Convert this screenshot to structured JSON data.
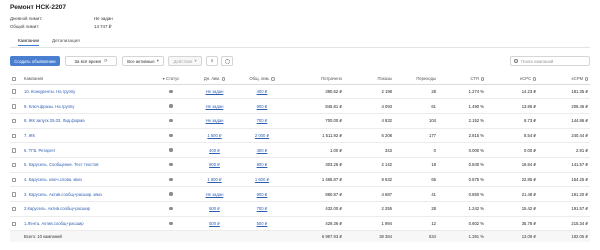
{
  "page": {
    "title": "Ремонт НСК-2207",
    "daily_limit_label": "Дневной лимит:",
    "daily_limit_value": "Не задан",
    "total_limit_label": "Общий лимит:",
    "total_limit_value": "14 747 ₽"
  },
  "tabs": [
    {
      "label": "Кампании",
      "active": true
    },
    {
      "label": "Детализация",
      "active": false
    }
  ],
  "toolbar": {
    "create_label": "Создать объявление",
    "period_label": "За всё время",
    "filter_label": "Все активные",
    "actions_label": "Действия",
    "search_placeholder": "Поиск кампаний"
  },
  "table": {
    "headers": {
      "campaign": "Кампания",
      "status": "Статус",
      "daily_limit": "Дн. лим.",
      "total_limit": "Общ. лим.",
      "spent": "Потрачено",
      "impressions": "Показы",
      "clicks": "Переходы",
      "ctr": "CTR",
      "ecpc": "eCPC",
      "ecpm": "eCPM"
    },
    "rows": [
      {
        "name": "10. Конкуренты. На группу",
        "daily": "Не задан",
        "total": "400 ₽",
        "spent": "390.62 ₽",
        "impressions": "2 198",
        "clicks": "28",
        "ctr": "1.274 %",
        "ecpc": "14.23 ₽",
        "ecpm": "181.35 ₽"
      },
      {
        "name": "9. Ключ.фразы. На группу",
        "daily": "Не задан",
        "total": "900 ₽",
        "spent": "845.81 ₽",
        "impressions": "4 093",
        "clicks": "61",
        "ctr": "1.490 %",
        "ecpc": "13.86 ₽",
        "ecpm": "206.45 ₽"
      },
      {
        "name": "8. ЖК запуск 25.03. Лид.форма",
        "daily": "Не задан",
        "total": "700 ₽",
        "spent": "700.00 ₽",
        "impressions": "4 832",
        "clicks": "104",
        "ctr": "2.152 %",
        "ecpc": "6.73 ₽",
        "ecpm": "144.86 ₽"
      },
      {
        "name": "7. ЖК",
        "daily": "1 500 ₽",
        "total": "2 000 ₽",
        "spent": "1 511.92 ₽",
        "impressions": "6 208",
        "clicks": "177",
        "ctr": "2.815 %",
        "ecpc": "8.54 ₽",
        "ecpm": "240.44 ₽"
      },
      {
        "name": "6. ТГБ. Ретаргет",
        "daily": "400 ₽",
        "total": "400 ₽",
        "spent": "1.00 ₽",
        "impressions": "343",
        "clicks": "0",
        "ctr": "0.000 %",
        "ecpc": "0.00 ₽",
        "ecpm": "2.91 ₽"
      },
      {
        "name": "5. Карусель. Сообщение. Тест текстов",
        "daily": "800 ₽",
        "total": "800 ₽",
        "spent": "303.26 ₽",
        "impressions": "2 142",
        "clicks": "18",
        "ctr": "0.840 %",
        "ecpc": "16.84 ₽",
        "ecpm": "141.57 ₽"
      },
      {
        "name": "4. Карусель. ключ.слова. квиз",
        "daily": "1 600 ₽",
        "total": "1 600 ₽",
        "spent": "1 485.87 ₽",
        "impressions": "9 632",
        "clicks": "65",
        "ctr": "0.675 %",
        "ecpc": "22.85 ₽",
        "ecpm": "154.25 ₽"
      },
      {
        "name": "3. Карусель. Актив.сообщ+расшир. квиз",
        "daily": "Не задан",
        "total": "900 ₽",
        "spent": "880.87 ₽",
        "impressions": "4 687",
        "clicks": "41",
        "ctr": "0.850 %",
        "ecpc": "21.48 ₽",
        "ecpm": "191.20 ₽"
      },
      {
        "name": "2.Карусель. Актив.сообщ+расшир",
        "daily": "500 ₽",
        "total": "700 ₽",
        "spent": "432.00 ₽",
        "impressions": "2 255",
        "clicks": "28",
        "ctr": "1.242 %",
        "ecpc": "15.42 ₽",
        "ecpm": "191.57 ₽"
      },
      {
        "name": "1.Лента. Актив.сообщ+расшир",
        "daily": "500 ₽",
        "total": "500 ₽",
        "spent": "429.36 ₽",
        "impressions": "1 994",
        "clicks": "12",
        "ctr": "0.602 %",
        "ecpc": "35.78 ₽",
        "ecpm": "215.34 ₽"
      }
    ],
    "total": {
      "label": "Всего: 10 кампаний",
      "spent": "6 987.93 ₽",
      "impressions": "38 384",
      "clicks": "534",
      "ctr": "1.391 %",
      "ecpc": "13.09 ₽",
      "ecpm": "182.05 ₽"
    }
  }
}
